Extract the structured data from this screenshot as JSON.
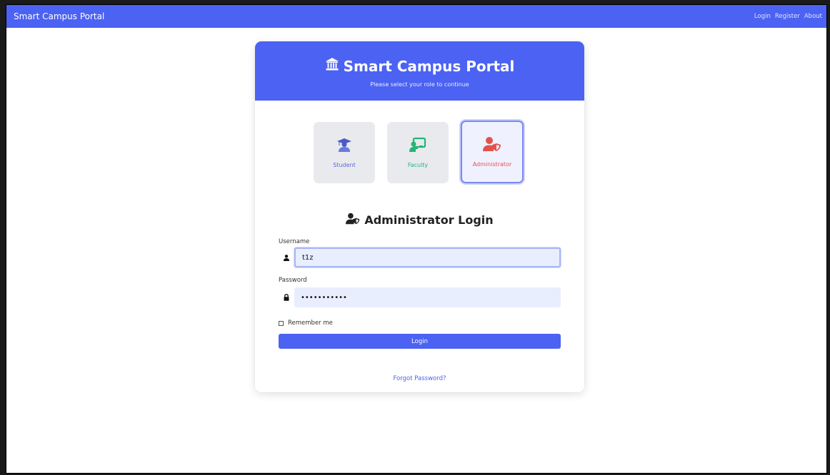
{
  "navbar": {
    "brand": "Smart Campus Portal",
    "links": [
      "Login",
      "Register",
      "About"
    ]
  },
  "header": {
    "title": "Smart Campus Portal",
    "subtitle": "Please select your role to continue",
    "icon": "bank-icon"
  },
  "roles": [
    {
      "label": "Student",
      "icon": "graduate-icon",
      "color": "#5b68d6",
      "selected": false
    },
    {
      "label": "Faculty",
      "icon": "teacher-board-icon",
      "color": "#25b576",
      "selected": false
    },
    {
      "label": "Administrator",
      "icon": "user-shield-icon",
      "color": "#e2524d",
      "selected": true
    }
  ],
  "login": {
    "title": "Administrator Login",
    "title_icon": "user-shield-icon"
  },
  "form": {
    "username_label": "Username",
    "username_value": "t1z",
    "password_label": "Password",
    "password_value": "•••••••••••",
    "remember_label": "Remember me",
    "login_label": "Login",
    "forgot_label": "Forgot Password?"
  },
  "colors": {
    "primary": "#4b62f2",
    "student": "#5b68d6",
    "faculty": "#25b576",
    "admin": "#e2524d"
  }
}
